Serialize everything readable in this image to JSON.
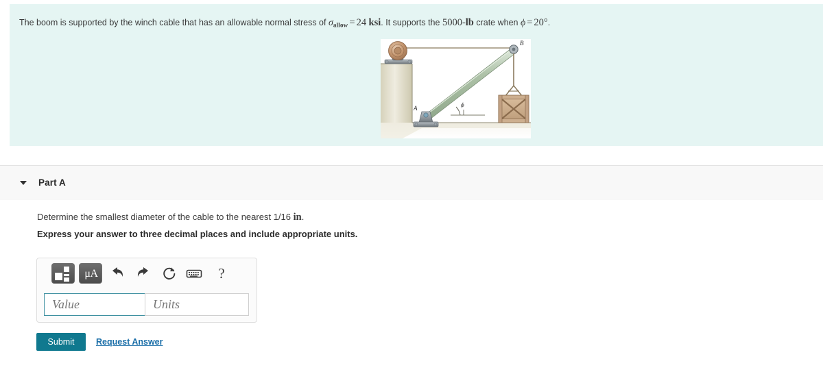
{
  "problem": {
    "text_part1": "The boom is supported by the winch cable that has an allowable normal stress of ",
    "sigma_symbol": "σ",
    "sigma_subscript": "allow",
    "equals_1": "=",
    "stress_value": "24",
    "stress_unit": "ksi",
    "text_part2": ". It supports the ",
    "load_value": "5000-",
    "load_unit": "lb",
    "text_part3": " crate when ",
    "phi_symbol": "ϕ",
    "equals_2": "=",
    "angle_value": "20",
    "angle_degree": "°",
    "text_end": ".",
    "background_color": "#e5f5f3"
  },
  "figure": {
    "name": "boom-winch-cable-crate-diagram",
    "label_b": "B",
    "label_a": "A",
    "label_phi": "ϕ",
    "background_color": "#ffffff",
    "boom_color": "#b9ccb4",
    "cable_color": "#8a7a5e",
    "ground_color": "#d9d5c0",
    "pulley_color": "#c39878",
    "crate_color": "#c7a98a",
    "bracket_color": "#8e969c"
  },
  "part": {
    "caret": "collapse-caret",
    "title": "Part A",
    "header_background": "#f8f8f8"
  },
  "question": {
    "line1_prefix": "Determine the smallest diameter of the cable to the nearest 1/16 ",
    "line1_unit": "in",
    "line1_suffix": ".",
    "line2": "Express your answer to three decimal places and include appropriate units."
  },
  "toolbar": {
    "buttons": [
      {
        "name": "math-template-icon",
        "label": ""
      },
      {
        "name": "units-icon",
        "label": "μÅ"
      },
      {
        "name": "undo-icon",
        "label": ""
      },
      {
        "name": "redo-icon",
        "label": ""
      },
      {
        "name": "reset-icon",
        "label": ""
      },
      {
        "name": "keyboard-icon",
        "label": ""
      },
      {
        "name": "help-icon",
        "label": "?"
      }
    ],
    "units_label": "μA",
    "help_label": "?"
  },
  "answer": {
    "value_placeholder": "Value",
    "value_current": "",
    "units_placeholder": "Units",
    "units_current": "",
    "value_border_color": "#3d8fa0"
  },
  "actions": {
    "submit_label": "Submit",
    "request_answer_label": "Request Answer",
    "submit_color": "#10798f",
    "link_color": "#1a6ea8"
  }
}
